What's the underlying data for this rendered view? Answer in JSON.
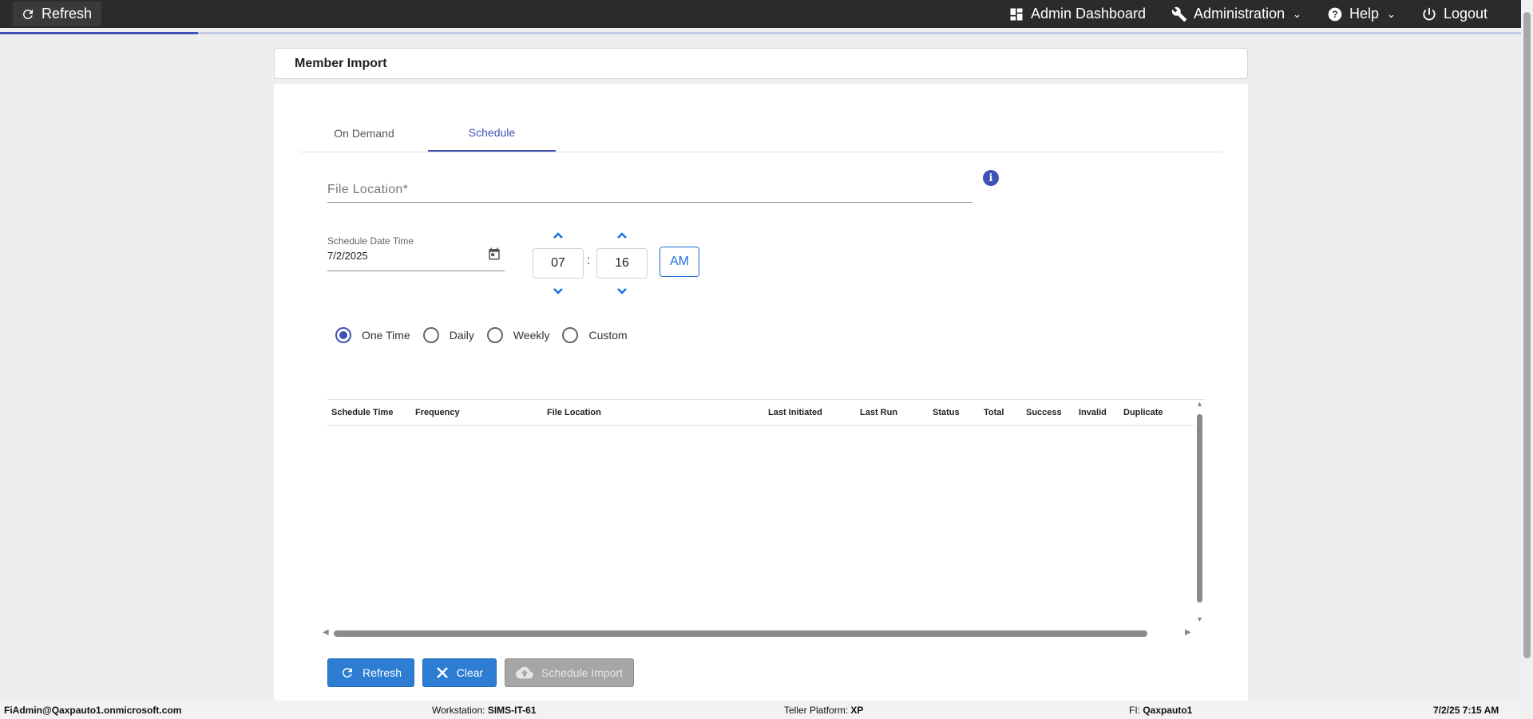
{
  "topbar": {
    "refresh_label": "Refresh",
    "nav": {
      "admin_dashboard": "Admin Dashboard",
      "administration": "Administration",
      "help": "Help",
      "logout": "Logout"
    }
  },
  "page": {
    "title": "Member Import"
  },
  "tabs": [
    {
      "label": "On Demand"
    },
    {
      "label": "Schedule"
    }
  ],
  "form": {
    "file_location_label": "File Location*",
    "schedule_label": "Schedule Date Time",
    "schedule_date": "7/2/2025",
    "hour": "07",
    "minute": "16",
    "time_separator": ":",
    "ampm": "AM"
  },
  "frequency": {
    "options": [
      "One Time",
      "Daily",
      "Weekly",
      "Custom"
    ],
    "selected": "One Time"
  },
  "table": {
    "columns": [
      "Schedule Time",
      "Frequency",
      "File Location",
      "Last Initiated",
      "Last Run",
      "Status",
      "Total",
      "Success",
      "Invalid",
      "Duplicate"
    ]
  },
  "actions": {
    "refresh": "Refresh",
    "clear": "Clear",
    "schedule_import": "Schedule Import"
  },
  "statusbar": {
    "user": "FiAdmin@Qaxpauto1.onmicrosoft.com",
    "workstation_label": "Workstation: ",
    "workstation": "SIMS-IT-61",
    "platform_label": "Teller Platform: ",
    "platform": "XP",
    "fi_label": "FI: ",
    "fi": "Qaxpauto1",
    "datetime": "7/2/25 7:15 AM"
  },
  "colors": {
    "accent": "#3f51b5",
    "button_blue": "#2d7dd2",
    "topbar": "#2b2b2b"
  }
}
